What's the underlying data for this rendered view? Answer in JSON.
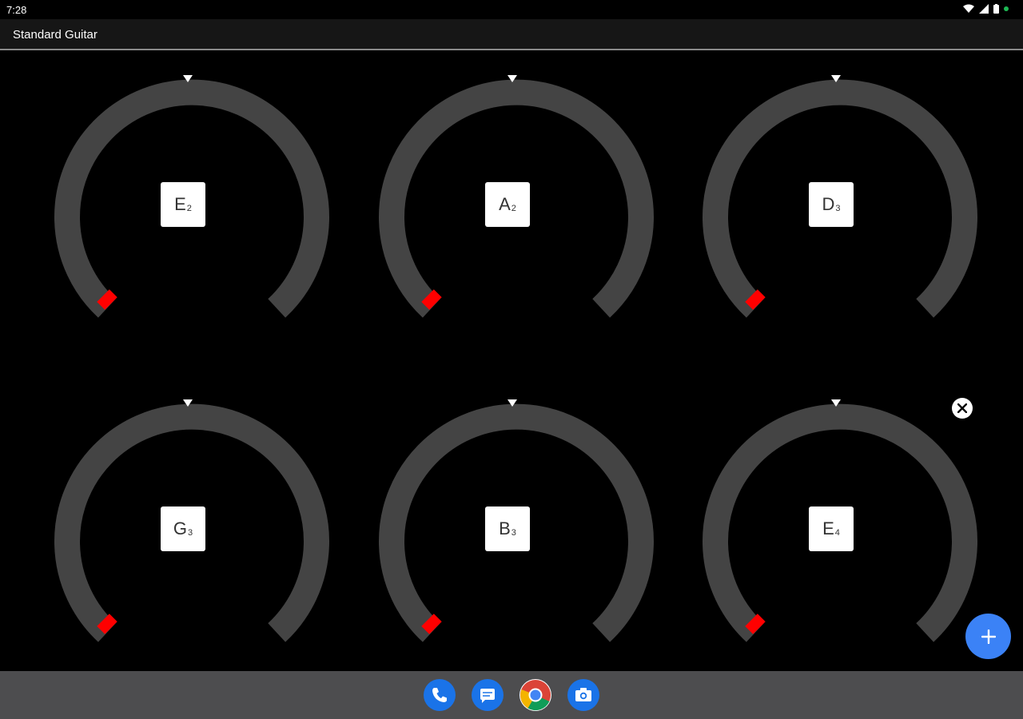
{
  "status_bar": {
    "time": "7:28",
    "icons": [
      "wifi-icon",
      "signal-icon",
      "battery-icon",
      "notification-dot-icon"
    ]
  },
  "app_bar": {
    "title": "Standard Guitar"
  },
  "tuners": [
    {
      "note": "E",
      "octave": "2"
    },
    {
      "note": "A",
      "octave": "2"
    },
    {
      "note": "D",
      "octave": "3"
    },
    {
      "note": "G",
      "octave": "3"
    },
    {
      "note": "B",
      "octave": "3"
    },
    {
      "note": "E",
      "octave": "4"
    }
  ],
  "controls": {
    "close_icon": "close-icon",
    "fab_icon": "plus-icon"
  },
  "dock": {
    "apps": [
      "phone-icon",
      "messages-icon",
      "chrome-icon",
      "camera-icon"
    ]
  },
  "colors": {
    "arc": "#444444",
    "indicator": "#ff0000",
    "fab": "#3b82f6",
    "note_box": "#ffffff"
  }
}
